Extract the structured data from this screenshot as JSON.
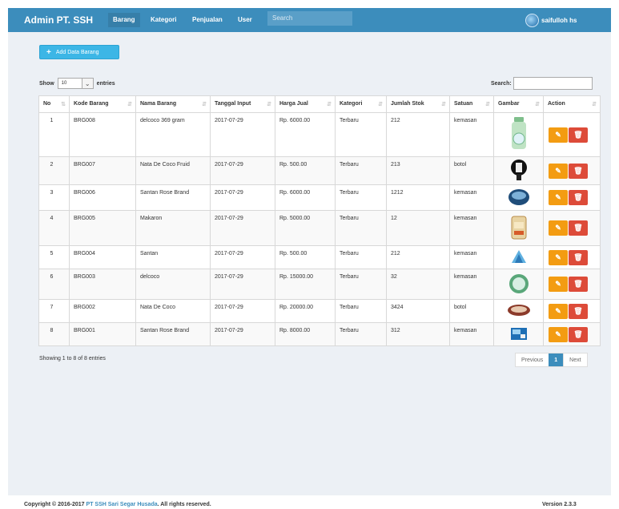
{
  "brand": "Admin PT. SSH",
  "nav": {
    "items": [
      "Barang",
      "Kategori",
      "Penjualan",
      "User"
    ],
    "search_placeholder": "Search",
    "user_name": "saifulloh hs"
  },
  "toolbar": {
    "add_label": "Add Data Barang",
    "add_icon": "plus-icon"
  },
  "length": {
    "show_label": "Show",
    "value": "10",
    "entries_label": "entries"
  },
  "search": {
    "label": "Search:",
    "value": ""
  },
  "table": {
    "columns": [
      "No",
      "Kode Barang",
      "Nama Barang",
      "Tanggal Input",
      "Harga Jual",
      "Kategori",
      "Jumlah Stok",
      "Satuan",
      "Gambar",
      "Action"
    ],
    "rows": [
      {
        "no": "1",
        "kode": "BRG008",
        "nama": "delcoco 369 gram",
        "tanggal": "2017-07-29",
        "harga": "Rp. 6000.00",
        "kategori": "Terbaru",
        "stok": "212",
        "satuan": "kemasan",
        "gambar": "product-bottle"
      },
      {
        "no": "2",
        "kode": "BRG007",
        "nama": "Nata De Coco Fruid",
        "tanggal": "2017-07-29",
        "harga": "Rp. 500.00",
        "kategori": "Terbaru",
        "stok": "213",
        "satuan": "botol",
        "gambar": "product-cup"
      },
      {
        "no": "3",
        "kode": "BRG006",
        "nama": "Santan Rose Brand",
        "tanggal": "2017-07-29",
        "harga": "Rp. 6000.00",
        "kategori": "Terbaru",
        "stok": "1212",
        "satuan": "kemasan",
        "gambar": "product-tray"
      },
      {
        "no": "4",
        "kode": "BRG005",
        "nama": "Makaron",
        "tanggal": "2017-07-29",
        "harga": "Rp. 5000.00",
        "kategori": "Terbaru",
        "stok": "12",
        "satuan": "kemasan",
        "gambar": "product-pack"
      },
      {
        "no": "5",
        "kode": "BRG004",
        "nama": "Santan",
        "tanggal": "2017-07-29",
        "harga": "Rp. 500.00",
        "kategori": "Terbaru",
        "stok": "212",
        "satuan": "kemasan",
        "gambar": "product-sachet"
      },
      {
        "no": "6",
        "kode": "BRG003",
        "nama": "delcoco",
        "tanggal": "2017-07-29",
        "harga": "Rp. 15000.00",
        "kategori": "Terbaru",
        "stok": "32",
        "satuan": "kemasan",
        "gambar": "product-jar"
      },
      {
        "no": "7",
        "kode": "BRG002",
        "nama": "Nata De Coco",
        "tanggal": "2017-07-29",
        "harga": "Rp. 20000.00",
        "kategori": "Terbaru",
        "stok": "3424",
        "satuan": "botol",
        "gambar": "product-bowl"
      },
      {
        "no": "8",
        "kode": "BRG001",
        "nama": "Santan Rose Brand",
        "tanggal": "2017-07-29",
        "harga": "Rp. 8000.00",
        "kategori": "Terbaru",
        "stok": "312",
        "satuan": "kemasan",
        "gambar": "product-box"
      }
    ]
  },
  "pagination": {
    "info": "Showing 1 to 8 of 8 entries",
    "previous": "Previous",
    "current": "1",
    "next": "Next"
  },
  "footer": {
    "prefix": "Copyright © 2016-2017 ",
    "company": "PT SSH Sari Segar Husada",
    "suffix": ". All rights reserved.",
    "version": "Version 2.3.3"
  },
  "colors": {
    "primary": "#3c8dbc",
    "edit": "#f39c12",
    "delete": "#dd4b39",
    "add": "#3cb6e6"
  }
}
